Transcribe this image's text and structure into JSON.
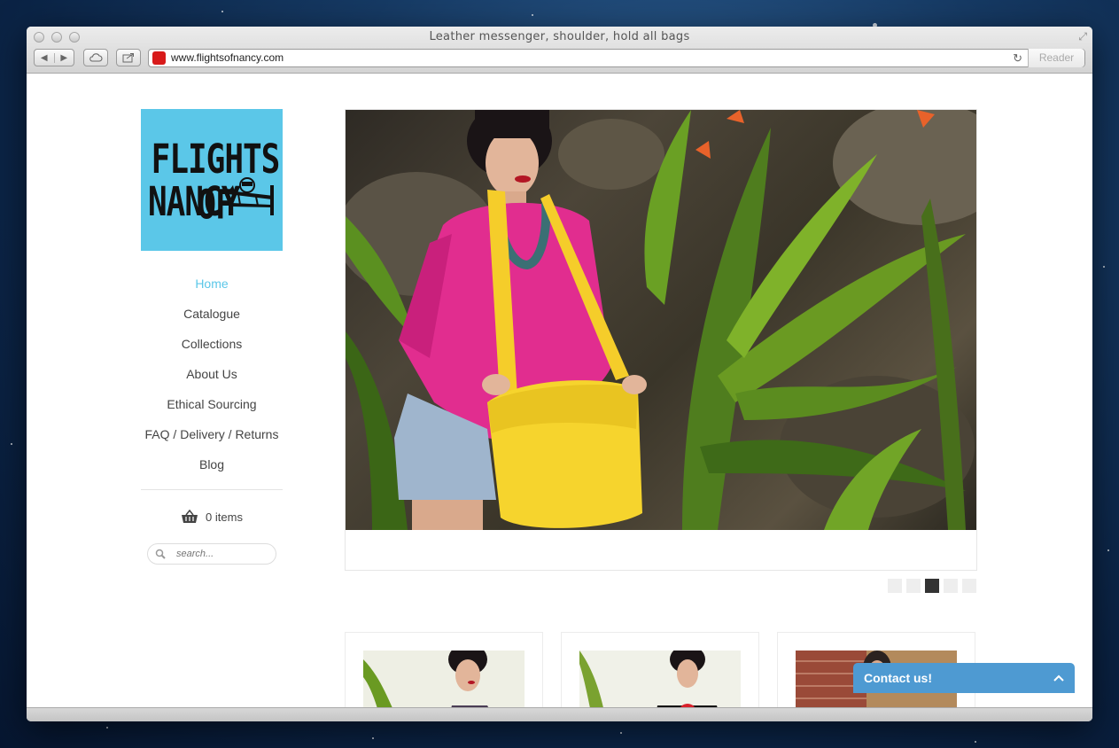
{
  "window": {
    "title": "Leather messenger, shoulder, hold all bags"
  },
  "toolbar": {
    "url": "www.flightsofnancy.com",
    "reader_label": "Reader"
  },
  "logo": {
    "line1": "FLIGHTS OF",
    "line2": "NANCY"
  },
  "nav": {
    "items": [
      {
        "label": "Home",
        "active": true
      },
      {
        "label": "Catalogue"
      },
      {
        "label": "Collections"
      },
      {
        "label": "About Us"
      },
      {
        "label": "Ethical Sourcing"
      },
      {
        "label": "FAQ / Delivery / Returns"
      },
      {
        "label": "Blog"
      }
    ]
  },
  "cart": {
    "label": "0 items"
  },
  "search": {
    "placeholder": "search..."
  },
  "slider": {
    "dot_count": 5,
    "active_dot": 3
  },
  "contact": {
    "label": "Contact us!"
  },
  "colors": {
    "accent": "#5bc7e8",
    "contact": "#4e9ad2"
  }
}
